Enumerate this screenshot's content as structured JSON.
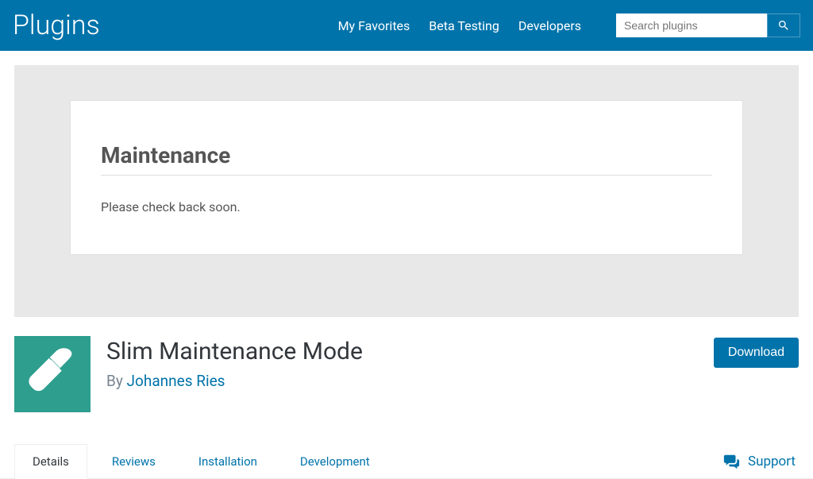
{
  "header": {
    "title": "Plugins",
    "nav": {
      "favorites": "My Favorites",
      "beta": "Beta Testing",
      "developers": "Developers"
    },
    "search": {
      "placeholder": "Search plugins"
    }
  },
  "banner": {
    "card_title": "Maintenance",
    "card_text": "Please check back soon."
  },
  "plugin": {
    "title": "Slim Maintenance Mode",
    "by_prefix": "By ",
    "author": "Johannes Ries",
    "download_label": "Download"
  },
  "tabs": {
    "details": "Details",
    "reviews": "Reviews",
    "installation": "Installation",
    "development": "Development"
  },
  "support": {
    "label": "Support"
  }
}
